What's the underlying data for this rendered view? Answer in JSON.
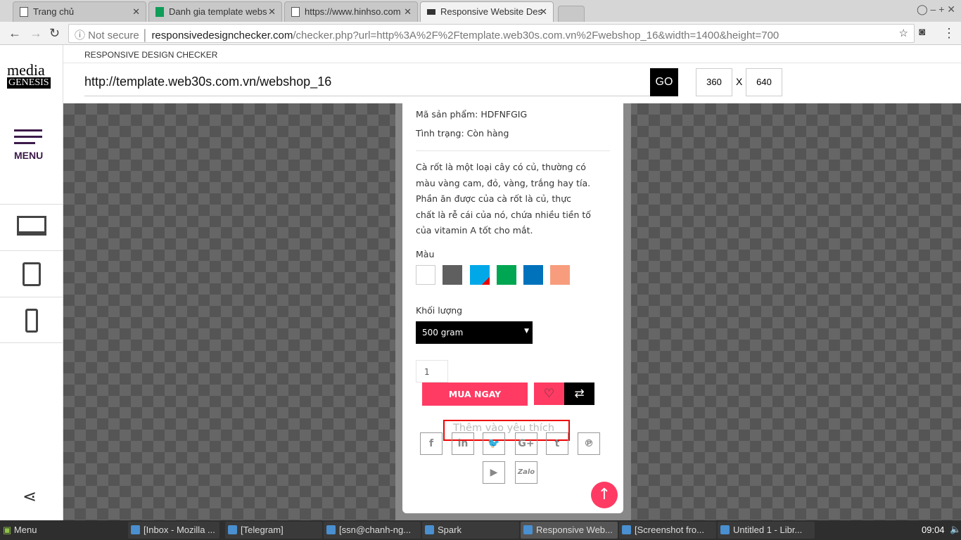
{
  "browser": {
    "tabs": [
      {
        "label": "Trang chủ"
      },
      {
        "label": "Danh gia template webs"
      },
      {
        "label": "https://www.hinhso.com"
      },
      {
        "label": "Responsive Website Des"
      }
    ],
    "security": "Not secure",
    "url_domain": "responsivedesignchecker.com",
    "url_path": "/checker.php?url=http%3A%2F%2Ftemplate.web30s.com.vn%2Fwebshop_16&width=1400&height=700"
  },
  "sidebar": {
    "logo_top": "media",
    "logo_bottom": "GENESIS",
    "menu_label": "MENU"
  },
  "header": {
    "title": "RESPONSIVE DESIGN CHECKER",
    "url_value": "http://template.web30s.com.vn/webshop_16",
    "go_label": "GO",
    "width": "360",
    "x": "X",
    "height": "640"
  },
  "product": {
    "sku": "Mã sản phẩm: HDFNFGIG",
    "status": "Tình trạng: Còn hàng",
    "description": [
      "Cà rốt là một loại cây có củ, thường có",
      "màu vàng cam, đỏ, vàng, trắng hay tía.",
      "Phần ăn được của cà rốt là củ, thực",
      "chất là rễ cái của nó, chứa nhiều tiền tố",
      "của vitamin A tốt cho mắt."
    ],
    "color_label": "Màu",
    "colors": [
      "#ffffff",
      "#5f5f5f",
      "#00a8e8",
      "#00a651",
      "#0072bc",
      "#f79d7d"
    ],
    "weight_label": "Khối lượng",
    "weight_value": "500 gram",
    "quantity": "1",
    "buy_label": "MUA NGAY",
    "tooltip": "Thêm vào yêu thích",
    "zalo": "Zalo",
    "accent": "#ff3b63"
  },
  "taskbar": {
    "menu": "Menu",
    "items": [
      "[Inbox - Mozilla ...",
      "[Telegram]",
      "[ssn@chanh-ng...",
      "Spark",
      "Responsive Web...",
      "[Screenshot fro...",
      "Untitled 1 - Libr..."
    ],
    "clock": "09:04"
  }
}
